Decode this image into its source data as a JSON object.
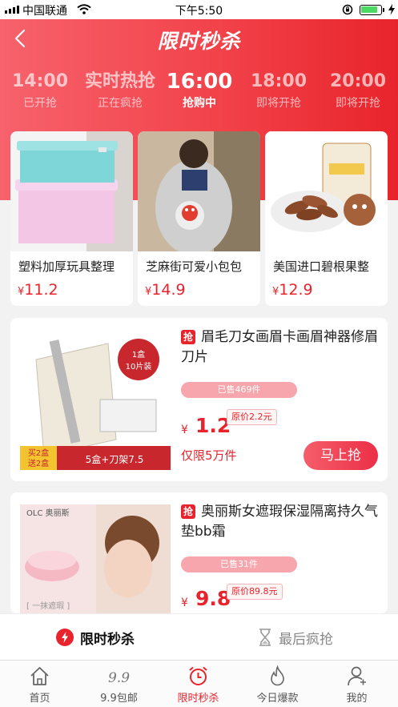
{
  "status_bar": {
    "carrier": "中国联通",
    "time": "下午5:50",
    "battery_level": 0.85
  },
  "header": {
    "title": "限时秒杀"
  },
  "slots": [
    {
      "time": "14:00",
      "status": "已开抢"
    },
    {
      "time": "实时热抢",
      "status": "正在疯抢"
    },
    {
      "time": "16:00",
      "status": "抢购中",
      "active": true
    },
    {
      "time": "18:00",
      "status": "即将开抢"
    },
    {
      "time": "20:00",
      "status": "即将开抢"
    }
  ],
  "featured": [
    {
      "name": "塑料加厚玩具整理",
      "currency": "¥",
      "price": "11.2"
    },
    {
      "name": "芝麻街可爱小包包",
      "currency": "¥",
      "price": "14.9"
    },
    {
      "name": "美国进口碧根果整",
      "currency": "¥",
      "price": "12.9"
    }
  ],
  "products": [
    {
      "badge": "抢",
      "name": "眉毛刀女画眉卡画眉神器修眉刀片",
      "sold": "已售469件",
      "currency": "¥",
      "price": "1.2",
      "original": "原价2.2元",
      "limit": "仅限5万件",
      "buy": "马上抢",
      "image_text": {
        "tag1": "1盒",
        "tag2": "10片装",
        "promo1": "买2盒",
        "promo2": "送2盒",
        "promo3": "5盒+刀架7.5"
      }
    },
    {
      "badge": "抢",
      "name": "奥丽斯女遮瑕保湿隔离持久气垫bb霜",
      "sold": "已售31件",
      "currency": "¥",
      "price": "9.8",
      "original": "原价89.8元",
      "image_text": {
        "brand": "OLC 奥丽斯",
        "tagline": "[ 一抹遮瑕 ]"
      }
    }
  ],
  "subtabs": {
    "flash": "限时秒杀",
    "last": "最后疯抢"
  },
  "tabbar": [
    {
      "label": "首页",
      "icon": "home-icon"
    },
    {
      "label": "9.9包邮",
      "icon": "nine-nine-icon"
    },
    {
      "label": "限时秒杀",
      "icon": "alarm-clock-icon",
      "active": true
    },
    {
      "label": "今日爆款",
      "icon": "flame-icon"
    },
    {
      "label": "我的",
      "icon": "user-icon"
    }
  ],
  "colors": {
    "accent": "#e8232c",
    "header_start": "#f7626c",
    "header_end": "#e8242b",
    "sold_bar": "#f7a6ad"
  }
}
